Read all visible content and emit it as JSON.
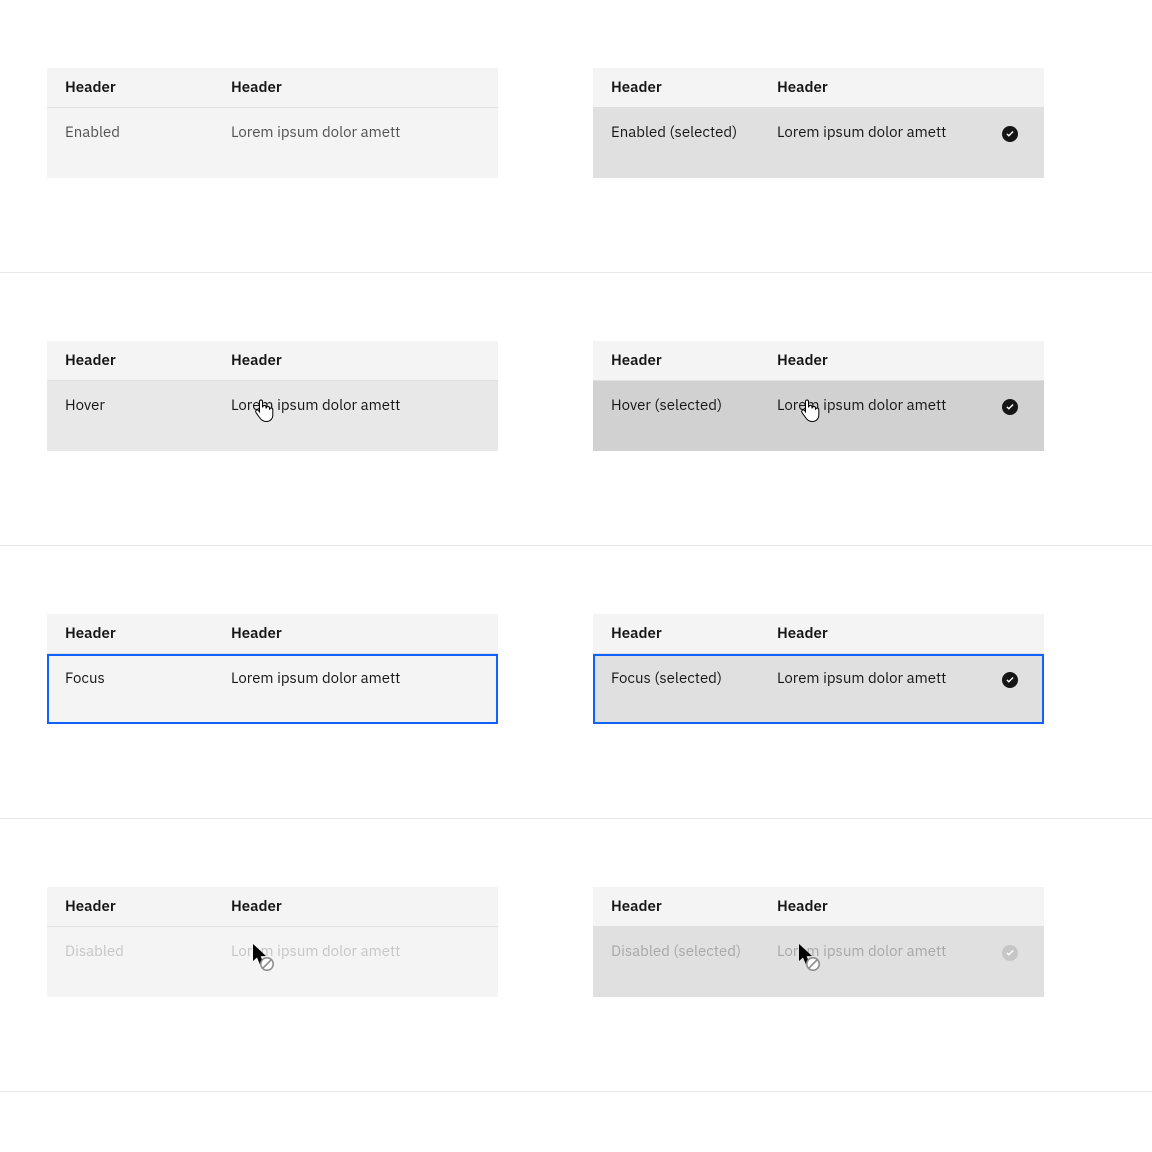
{
  "colors": {
    "focus_outline": "#0f62fe"
  },
  "header_label": "Header",
  "lorem": "Lorem ipsum dolor amett",
  "states": {
    "enabled": {
      "label": "Enabled",
      "selected_label": "Enabled (selected)"
    },
    "hover": {
      "label": "Hover",
      "selected_label": "Hover (selected)"
    },
    "focus": {
      "label": "Focus",
      "selected_label": "Focus (selected)"
    },
    "disabled": {
      "label": "Disabled",
      "selected_label": "Disabled (selected)"
    }
  },
  "icons": {
    "checkmark_filled": "checkmark-filled-icon",
    "pointer_cursor": "pointer-cursor-icon",
    "not_allowed_cursor": "not-allowed-cursor-icon"
  }
}
